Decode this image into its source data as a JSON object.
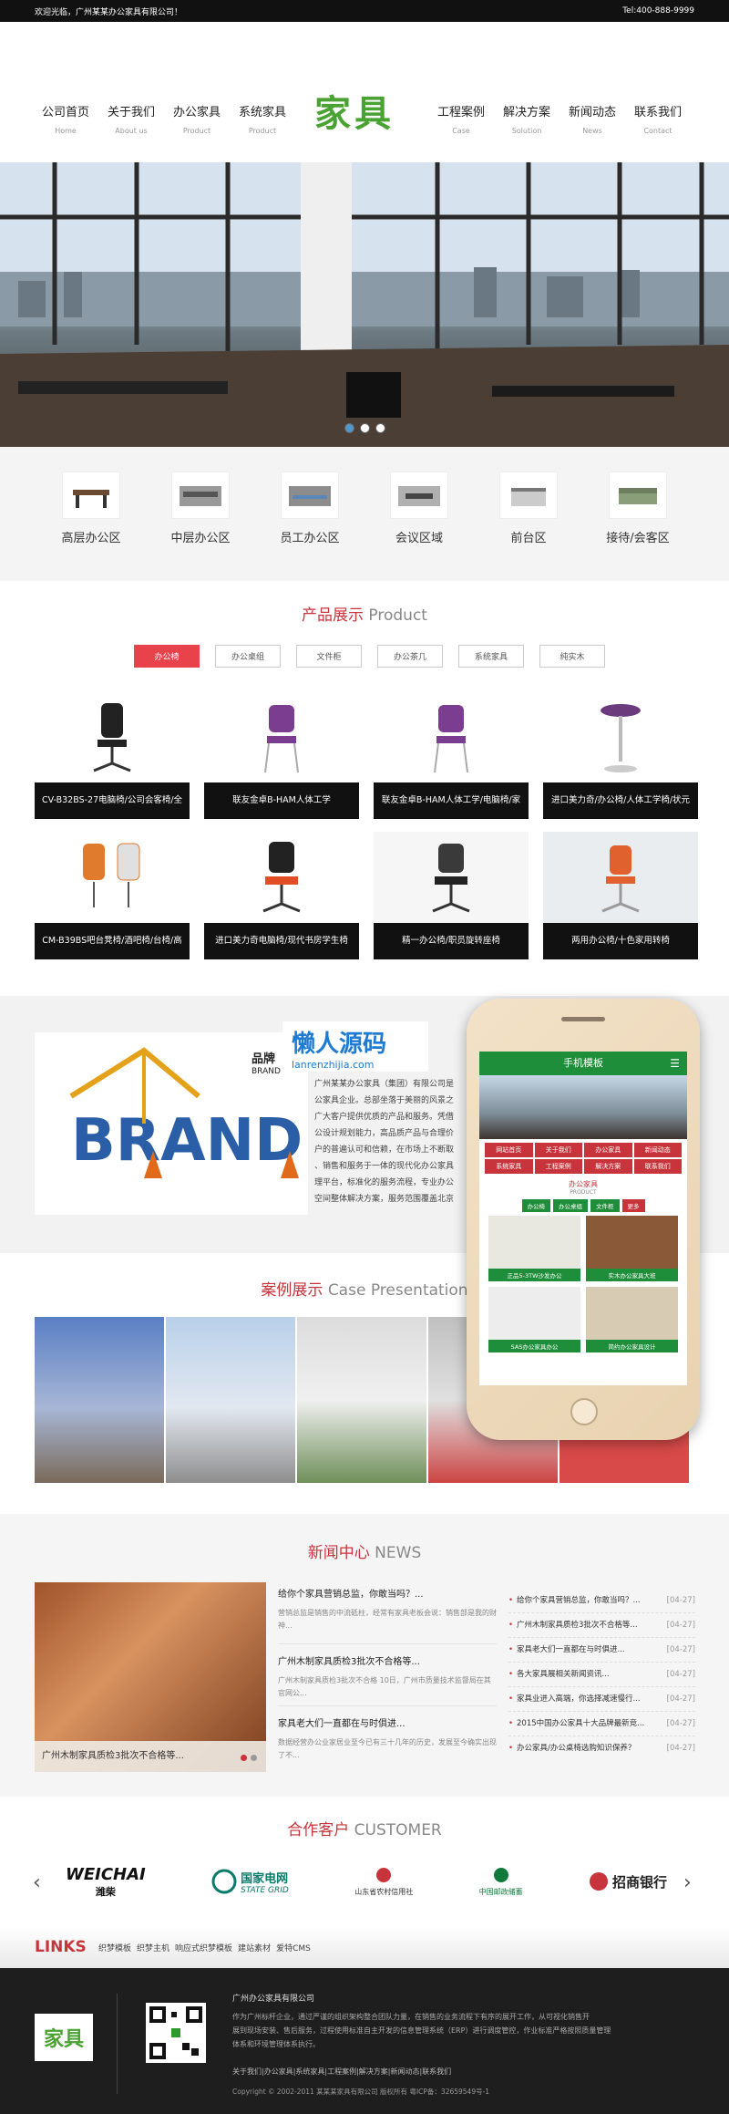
{
  "topbar": {
    "welcome": "欢迎光临，广州某某办公家具有限公司！",
    "tel": "Tel:400-888-9999"
  },
  "nav_left": [
    {
      "cn": "公司首页",
      "en": "Home"
    },
    {
      "cn": "关于我们",
      "en": "About us"
    },
    {
      "cn": "办公家具",
      "en": "Product"
    },
    {
      "cn": "系统家具",
      "en": "Product"
    }
  ],
  "nav_right": [
    {
      "cn": "工程案例",
      "en": "Case"
    },
    {
      "cn": "解决方案",
      "en": "Solution"
    },
    {
      "cn": "新闻动态",
      "en": "News"
    },
    {
      "cn": "联系我们",
      "en": "Contact"
    }
  ],
  "logo": "家具",
  "categories": [
    "高层办公区",
    "中层办公区",
    "员工办公区",
    "会议区域",
    "前台区",
    "接待/会客区"
  ],
  "product": {
    "title_cn": "产品展示",
    "title_en": "Product",
    "tabs": [
      "办公椅",
      "办公桌组",
      "文件柜",
      "办公茶几",
      "系统家具",
      "纯实木"
    ],
    "items": [
      "CV-B32BS-27电脑椅/公司会客椅/全",
      "联友金卓B-HAM人体工学",
      "联友金卓B-HAM人体工学/电脑椅/家",
      "进口美力奇/办公椅/人体工学椅/状元",
      "CM-B39BS吧台凳椅/酒吧椅/台椅/高",
      "进口美力奇电脑椅/现代书房学生椅",
      "精一办公椅/职员旋转座椅",
      "两用办公椅/十色家用转椅"
    ]
  },
  "about": {
    "brand_cn": "品牌",
    "brand_en": "BRAND",
    "brand_big": "BRAND",
    "watermark_cn": "懒人源码",
    "watermark_url": "lanrenzhijia.com",
    "text": [
      "广州某某办公家具（集团）有限公司是",
      "公家具企业。总部坐落于美丽的风景之",
      "广大客户提供优质的产品和服务。凭借",
      "公设计规划能力，高品质产品与合理价",
      "户的普遍认可和信赖，在市场上不断取",
      "、销售和服务于一体的现代化办公家具",
      "理平台，标准化的服务流程，专业办公",
      "空间整体解决方案，服务范围覆盖北京"
    ]
  },
  "phone": {
    "title": "手机模板",
    "menu": [
      "网站首页",
      "关于我们",
      "办公家具",
      "新闻动态",
      "系统家具",
      "工程案例",
      "解决方案",
      "联系我们"
    ],
    "section_cn": "办公家具",
    "section_en": "PRODUCT",
    "tabs": [
      "办公椅",
      "办公桌组",
      "文件柜",
      "更多"
    ],
    "items": [
      "正品5-3TW沙发办公",
      "实木办公家具大班",
      "SAS办公家具办公",
      "简约办公家具设计"
    ]
  },
  "cases": {
    "title_cn": "案例展示",
    "title_en": "Case Presentation"
  },
  "news": {
    "title_cn": "新闻中心",
    "title_en": "NEWS",
    "img_caption": "广州木制家具质检3批次不合格等...",
    "featured": [
      {
        "title": "给你个家具营销总监，你敢当吗？...",
        "desc": "营销总监是销售的中流砥柱，经常有家具老板会说：销售部是我的财神..."
      },
      {
        "title": "广州木制家具质检3批次不合格等...",
        "desc": "广州木制家具质检3批次不合格 10日，广州市质量技术监督局在其官网公..."
      },
      {
        "title": "家具老大们一直都在与时俱进...",
        "desc": "数据经营办公业家居业至今已有三十几年的历史，发展至今确实出现了不..."
      }
    ],
    "list": [
      {
        "t": "给你个家具营销总监，你敢当吗？...",
        "d": "[04-27]"
      },
      {
        "t": "广州木制家具质检3批次不合格等...",
        "d": "[04-27]"
      },
      {
        "t": "家具老大们一直都在与时俱进...",
        "d": "[04-27]"
      },
      {
        "t": "各大家具展相关新闻资讯...",
        "d": "[04-27]"
      },
      {
        "t": "家具业进入高端，你选择减速慢行...",
        "d": "[04-27]"
      },
      {
        "t": "2015中国办公家具十大品牌最新竞...",
        "d": "[04-27]"
      },
      {
        "t": "办公家具/办公桌椅选购知识保养？",
        "d": "[04-27]"
      }
    ]
  },
  "partners": {
    "title_cn": "合作客户",
    "title_en": "CUSTOMER",
    "logos": [
      "WEICHAI",
      "潍柴",
      "国家电网",
      "STATE GRID",
      "山东省农村信用社",
      "中国邮政储蓄",
      "招商银行"
    ]
  },
  "links": {
    "label": "LINKS",
    "items": [
      "织梦模板",
      "织梦主机",
      "响应式织梦模板",
      "建站素材",
      "爱特CMS"
    ]
  },
  "footer": {
    "logo": "家具",
    "company": "广州办公家具有限公司",
    "desc": [
      "作为广州标杆企业，通过严谨的组织架构整合团队力量，在销售的业务流程下有序的展开工作，从可视化销售开",
      "展到现场安装、售后服务，过程使用标准自主开发的信息管理系统（ERP）进行调度管控，作业标准严格按照质量管理",
      "体系和环境管理体系执行。"
    ],
    "links": "关于我们|办公家具|系统家具|工程案例|解决方案|新闻动态|联系我们",
    "copyright": "Copyright © 2002-2011 某某某家具有限公司 版权所有 粤ICP备：32659549号-1"
  },
  "colors": {
    "accent": "#c8343b",
    "logo_green": "#4aa233",
    "tab_red": "#e8424a",
    "footer_bg": "#1e1e1e"
  }
}
